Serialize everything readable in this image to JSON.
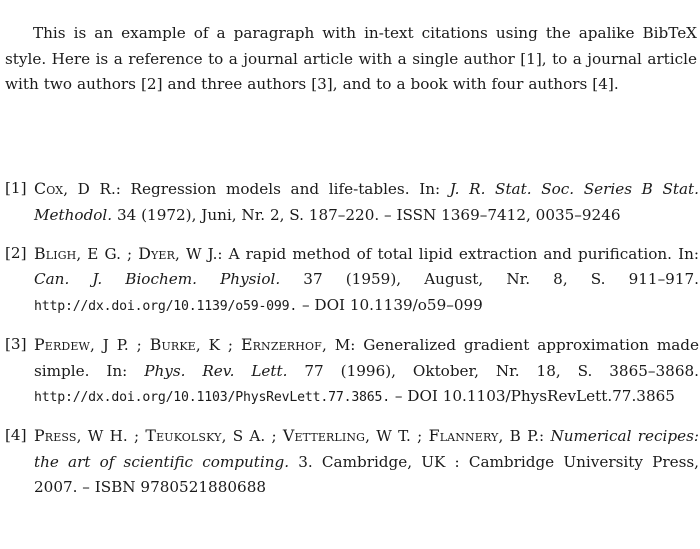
{
  "document": {
    "type": "latex-bibliography-page",
    "intro_paragraph": {
      "part1": "This is an example of a paragraph with in-text citations using the apalike BibTeX style. Here is a reference to a journal article with a single author [1], to a journal article with two authors [2] and three authors [3], and to a book with four authors [4]."
    },
    "bibliography": {
      "entries": [
        {
          "label": "[1]",
          "authors_smallcaps": "Cox",
          "authors_rest": ", D R.:",
          "title": " Regression models and life-tables. In: ",
          "journal_italic": "J. R. Stat. Soc. Series B Stat. Methodol.",
          "details": " 34 (1972), Juni, Nr. 2, S. 187–220. – ISSN 1369–7412, 0035–9246"
        },
        {
          "label": "[2]",
          "authors_smallcaps_1": "Bligh",
          "authors_mid_1": ", E G. ; ",
          "authors_smallcaps_2": "Dyer",
          "authors_rest": ", W J.:",
          "title": " A rapid method of total lipid extraction and purification. In: ",
          "journal_italic": "Can. J. Biochem. Physiol.",
          "details_pre": " 37 (1959), August, Nr. 8, S. 911–917. ",
          "url_mono": "http://dx.doi.org/10.1139/o59-099.",
          "details_post": " – DOI 10.1139/o59–099"
        },
        {
          "label": "[3]",
          "authors_smallcaps_1": "Perdew",
          "authors_mid_1": ", J P. ; ",
          "authors_smallcaps_2": "Burke",
          "authors_mid_2": ", K ; ",
          "authors_smallcaps_3": "Ernzerhof",
          "authors_rest": ", M:",
          "title": " Generalized gradient approximation made simple. In: ",
          "journal_italic": "Phys. Rev. Lett.",
          "details_pre": " 77 (1996), Oktober, Nr. 18, S. 3865–3868. ",
          "url_mono": "http://dx.doi.org/10.1103/PhysRevLett.77.3865.",
          "details_post": " – DOI 10.1103/PhysRevLett.77.3865"
        },
        {
          "label": "[4]",
          "authors_smallcaps_1": "Press",
          "authors_mid_1": ", W H. ; ",
          "authors_smallcaps_2": "Teukolsky",
          "authors_mid_2": ", S A. ; ",
          "authors_smallcaps_3": "Vetterling",
          "authors_mid_3": ", W T. ; ",
          "authors_smallcaps_4": "Flannery",
          "authors_rest": ", B P.: ",
          "title_italic": "Numerical recipes: the art of scientific computing.",
          "details": " 3. Cambridge, UK : Cambridge University Press, 2007. – ISBN 9780521880688"
        }
      ]
    }
  }
}
